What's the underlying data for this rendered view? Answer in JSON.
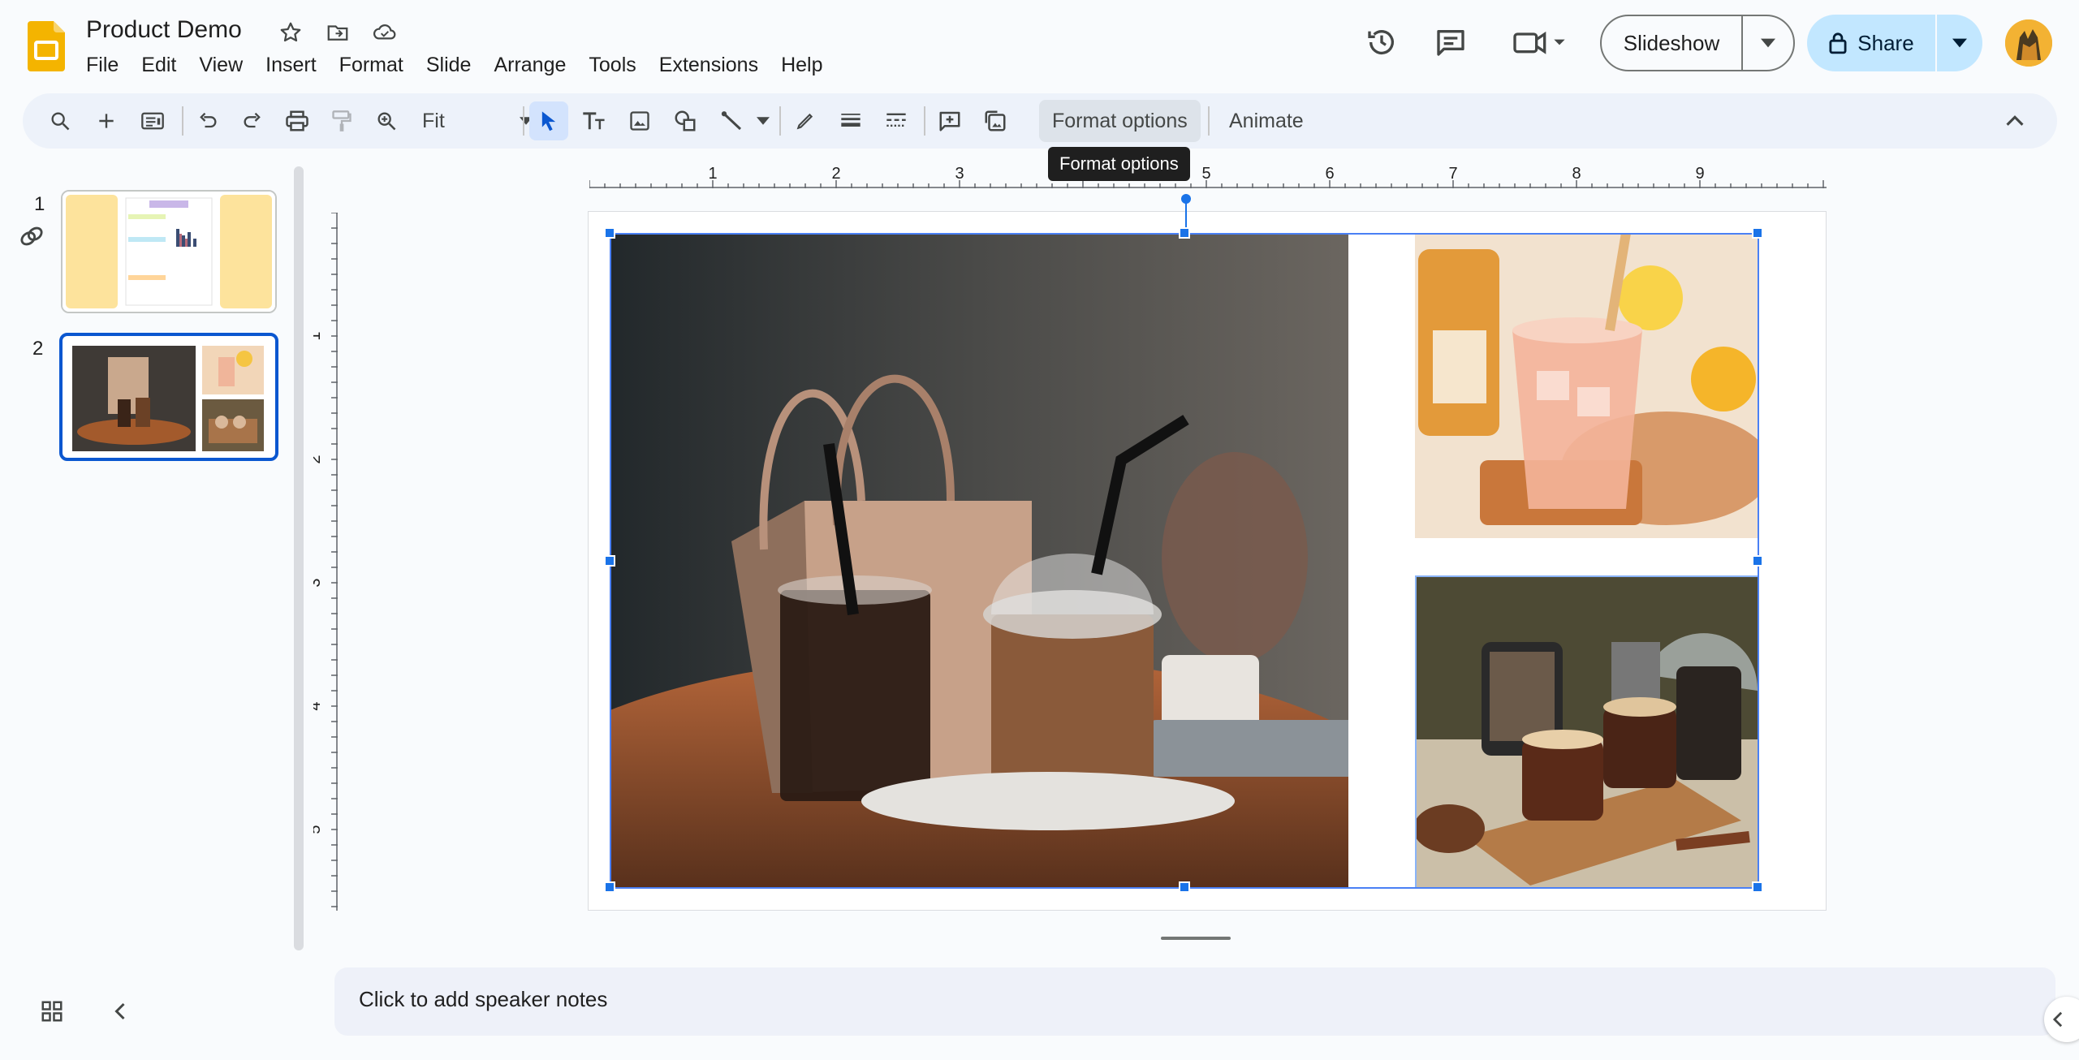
{
  "doc": {
    "title": "Product Demo"
  },
  "menu": [
    "File",
    "Edit",
    "View",
    "Insert",
    "Format",
    "Slide",
    "Arrange",
    "Tools",
    "Extensions",
    "Help"
  ],
  "header": {
    "slideshow_label": "Slideshow",
    "share_label": "Share"
  },
  "toolbar": {
    "zoom_value": "Fit",
    "format_options_label": "Format options",
    "animate_label": "Animate",
    "tooltip": "Format options"
  },
  "filmstrip": {
    "slides": [
      {
        "number": "1",
        "header_text": "Product Demo",
        "lines": [
          "product demo",
          "product demo",
          "product demo",
          "product demo",
          "product demo",
          "product demo",
          "product demo",
          "product demo"
        ],
        "captions": [
          "@productdemo",
          "@productdemo"
        ]
      },
      {
        "number": "2"
      }
    ]
  },
  "ruler": {
    "h_labels": [
      "1",
      "2",
      "3",
      "4",
      "5",
      "6",
      "7",
      "8",
      "9"
    ],
    "v_labels": [
      "1",
      "2",
      "3",
      "4",
      "5"
    ]
  },
  "notes": {
    "placeholder": "Click to add speaker notes"
  },
  "colors": {
    "accent": "#0b57d0",
    "share_bg": "#c2e7ff",
    "selection": "#1a73e8",
    "logo": "#f4b400"
  }
}
